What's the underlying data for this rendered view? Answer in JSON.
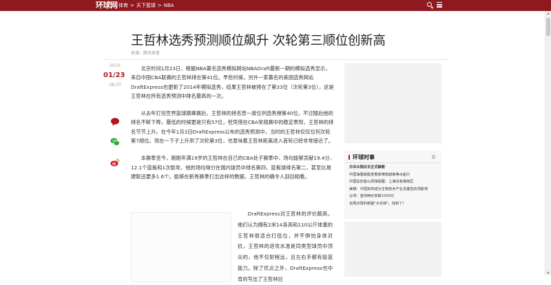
{
  "topbar": {
    "logo": "环球网",
    "breadcrumb": [
      "体育",
      "天下篮球",
      "NBA"
    ],
    "separator": ">",
    "bg_color": "#8e1a1f"
  },
  "article": {
    "title": "王哲林选秀预测顺位飙升 次轮第三顺位创新高",
    "source": "来源：腾讯体育",
    "date_year": "2013-",
    "date_md": "01/23",
    "date_time": "08:37",
    "accent_color": "#b4161b",
    "paragraphs": [
      "北京时间1月23日，根据NBA著名选秀模拟网站NBADraft最新一期的模拟选秀显示，来自中国CBA联赛的王哲林排在第41位。早些时候，另外一家著名的美国选秀网站DraftExpress也更新了2014年模拟选秀，结果王哲林被排在了第33位（次轮第3位），这是王哲林在所有选秀预测中排名最高的一次。",
      "从去年打完世界篮球巅峰赛后，王哲林的排名曾一度位列选秀榜第40位，不过随后他的排名不断下降，最低的时候更是只有57位，但凭借在CBA常规赛中的稳定表现，王哲林的排名节节上升。在今年1月3日DraftExpress公布的选秀预测中，当时的王哲林仅仅位列次轮第7顺位。现在一下子上升到了次轮第3位，也意味着王哲林距离进入首轮已经非常接近了。",
      "本赛季至今，刚刚年满19岁的王哲林在自己的CBA处子赛季中，场均能够贡献19.4分、12.1个篮板和1次助攻，他的场均得分在国内球员中排名第四，篮板球排名第二，甚至比易建联还要多1.6个。能够在新秀赛季打出这样的数据，王哲林的确令人刮目相看。"
    ],
    "paragraph_side": "DraftExpress对王哲林的评价颇高，他们认为拥有2米14身高和110公斤体重的王哲林很适合打低位，并不惧怕身体对抗，王哲林的进攻水准是同类型球员中顶尖的，他不仅射程远，且左右手都有投篮能力。除了优点之外，DraftExpress也中肯的写出了王哲林目"
  },
  "share_icons": [
    "comment-icon",
    "wechat-icon",
    "weibo-icon"
  ],
  "sidebar": {
    "hot_title": "环球时事",
    "hot_items": [
      "日本众院议长正式解散",
      "中国海警舰艇查看菲律宾越南等水船只",
      "中国驻旧金山领馆提醒：上海没有暴雨区",
      "美媒：中国如何成为生物技术产业关键性的领航地",
      "台湾：金饰两价突破1500元",
      "全网点赞的新疆\"大衣妹\"，找到了！"
    ]
  }
}
